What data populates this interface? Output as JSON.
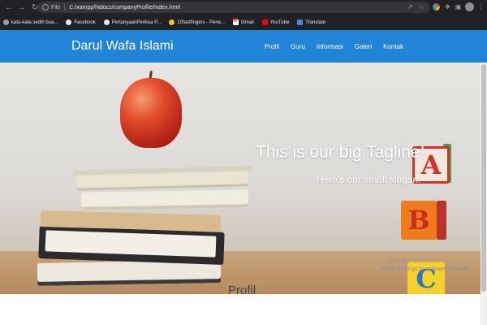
{
  "browser": {
    "scheme_label": "File",
    "url": "C:/xampp/htdocs/companyProfile/index.html",
    "bookmarks": [
      {
        "label": "kata-kata sedih bua...",
        "icon": "globe-icon"
      },
      {
        "label": "Facebook",
        "icon": "globe-icon"
      },
      {
        "label": "PertanyaanPeriksa P...",
        "icon": "globe-icon"
      },
      {
        "label": "10fastfingers - Pene...",
        "icon": "10fastfingers-icon"
      },
      {
        "label": "Gmail",
        "icon": "gmail-icon"
      },
      {
        "label": "YouTube",
        "icon": "youtube-icon"
      },
      {
        "label": "Translate",
        "icon": "translate-icon"
      }
    ]
  },
  "site": {
    "brand": "Darul Wafa Islami",
    "nav": [
      "Profil",
      "Guru",
      "Informasi",
      "Galeri",
      "Kontak"
    ],
    "nav_color": "#2284d6"
  },
  "hero": {
    "tagline": "This is our big Tagline!",
    "slogan": "Here's our small slogan."
  },
  "blocks": {
    "a": "A",
    "b": "B",
    "c": "C"
  },
  "section": {
    "heading": "Profil"
  },
  "windows_overlay": {
    "line1": "Activate Windows",
    "line2": "Go to Settings to activate Windows."
  }
}
